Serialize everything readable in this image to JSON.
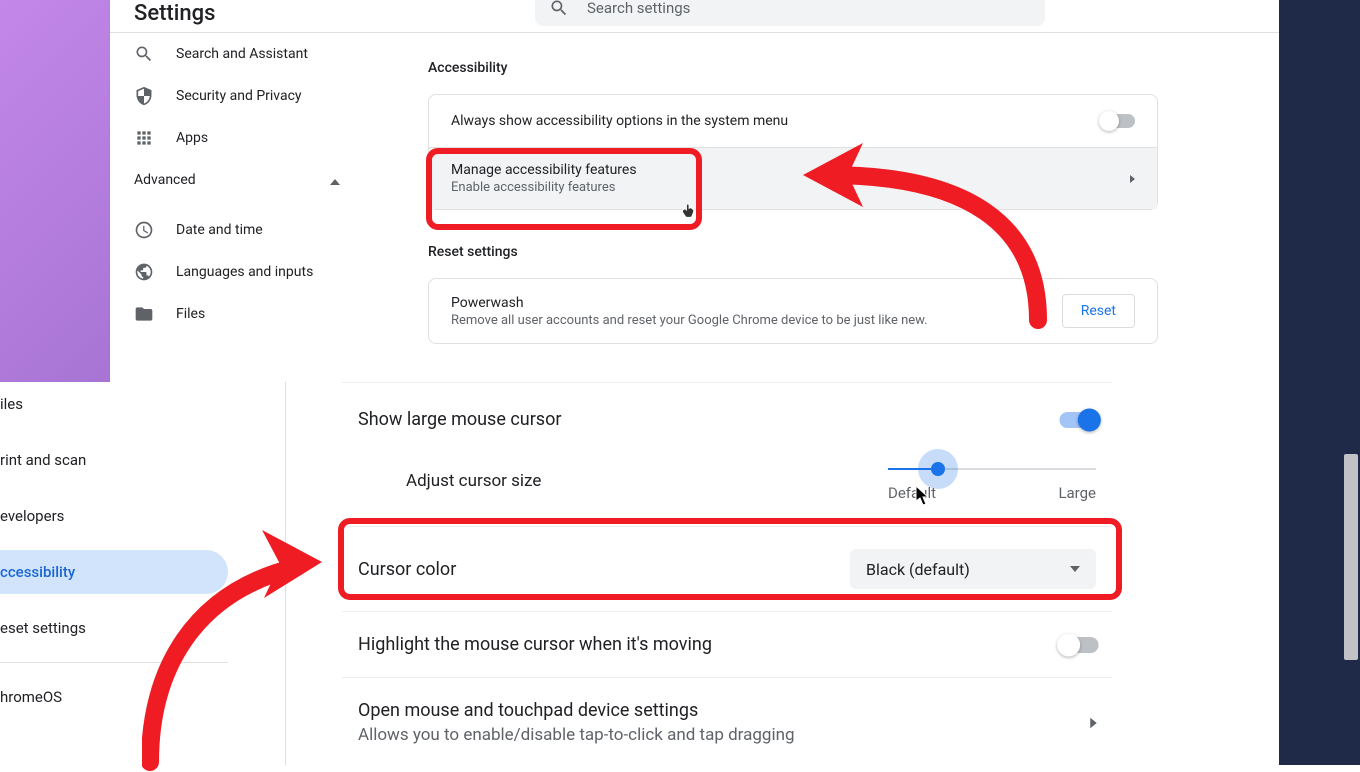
{
  "header": {
    "title": "Settings",
    "search_placeholder": "Search settings"
  },
  "sidebar_top": {
    "search_assistant": "Search and Assistant",
    "security_privacy": "Security and Privacy",
    "apps": "Apps",
    "advanced": "Advanced",
    "date_time": "Date and time",
    "languages_inputs": "Languages and inputs",
    "files": "Files"
  },
  "section": {
    "accessibility": {
      "title": "Accessibility",
      "always_show": "Always show accessibility options in the system menu",
      "manage_title": "Manage accessibility features",
      "manage_sub": "Enable accessibility features"
    },
    "reset": {
      "title": "Reset settings",
      "powerwash": "Powerwash",
      "powerwash_sub": "Remove all user accounts and reset your Google Chrome device to be just like new.",
      "reset_btn": "Reset"
    }
  },
  "sidebar_bottom": {
    "files": "iles",
    "print_scan": "rint and scan",
    "developers": "evelopers",
    "accessibility": "ccessibility",
    "reset_settings": "eset settings",
    "chromeos": "hromeOS"
  },
  "acc_panel": {
    "large_cursor": "Show large mouse cursor",
    "adjust_size": "Adjust cursor size",
    "slider_min": "Default",
    "slider_max": "Large",
    "cursor_color": "Cursor color",
    "cursor_color_value": "Black (default)",
    "highlight": "Highlight the mouse cursor when it's moving",
    "open_mouse_title": "Open mouse and touchpad device settings",
    "open_mouse_sub": "Allows you to enable/disable tap-to-click and tap dragging"
  }
}
